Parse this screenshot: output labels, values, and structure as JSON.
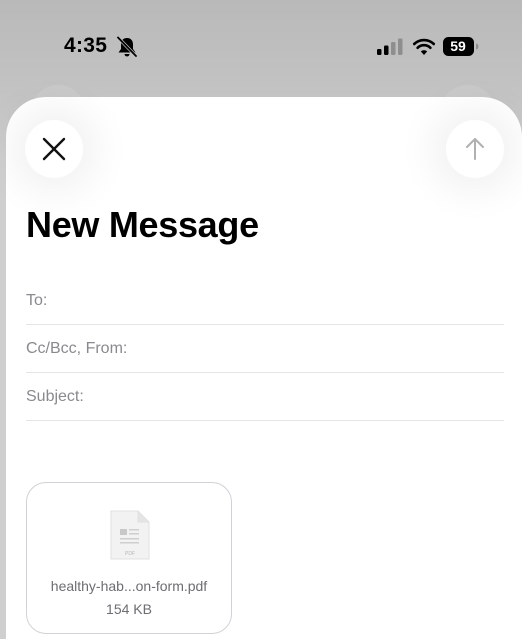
{
  "status_bar": {
    "time": "4:35",
    "battery": "59",
    "icons": [
      "bell-slash-icon",
      "signal-bars-icon",
      "wifi-icon",
      "battery-icon"
    ]
  },
  "compose": {
    "title": "New Message",
    "close_icon": "close-icon",
    "send_icon": "send-arrow-up-icon",
    "fields": {
      "to": "To:",
      "cc_bcc_from": "Cc/Bcc, From:",
      "subject": "Subject:"
    },
    "attachment": {
      "icon": "pdf-file-icon",
      "filename": "healthy-hab...on-form.pdf",
      "size": "154 KB"
    }
  },
  "colors": {
    "background": "#c4c4c4",
    "sheet": "#ffffff",
    "placeholder_text": "#8a8a8e",
    "send_arrow_disabled": "#b0b0b0"
  }
}
